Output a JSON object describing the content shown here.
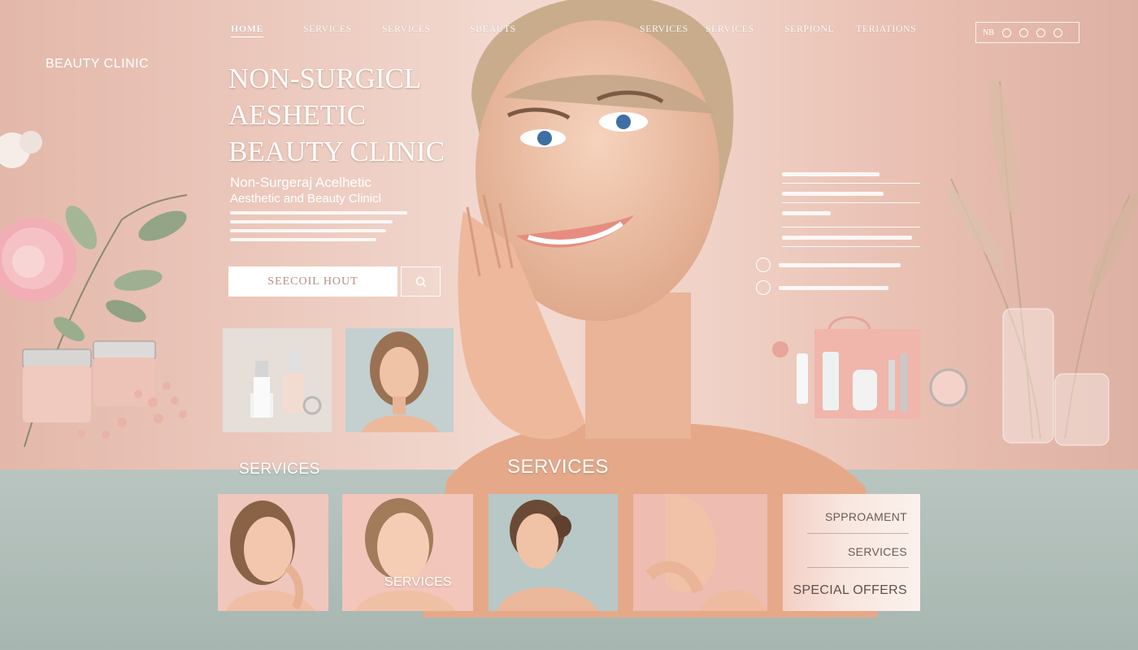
{
  "brand": {
    "name": "BEAUTY CLINIC"
  },
  "nav": {
    "items": [
      "HOME",
      "SERVICES",
      "SERVICES",
      "SBEAUTS",
      "SERVICES",
      "SERVICES",
      "SERPIONL",
      "TERIATIONS"
    ],
    "icons_text": "NB"
  },
  "hero": {
    "title_lines": [
      "NON-SURGICL",
      "AESHETIC",
      "BEAUTY CLINIC"
    ],
    "subtitle_lines": [
      "Non-Surgeraj Acelhetic",
      "Aesthetic and Beauty Clinicl"
    ],
    "cta_label": "SEECOIL HOUT"
  },
  "sections": {
    "services_heading_left": "SERVICES",
    "services_heading_center": "SERVICES"
  },
  "cards": {
    "card2_label": "SERVICES",
    "card5": {
      "option1": "SPPROAMENT",
      "option2": "SERVICES",
      "option3": "SPECIAL OFFERS"
    }
  },
  "colors": {
    "hero_bg": "#ebc7bb",
    "services_bg": "#b9c5c0",
    "accent_text": "#ffffff",
    "cta_text": "#b48f84"
  },
  "icons": [
    "search-icon",
    "cart-icon",
    "user-icon",
    "account-icon",
    "phone-icon",
    "location-icon"
  ]
}
